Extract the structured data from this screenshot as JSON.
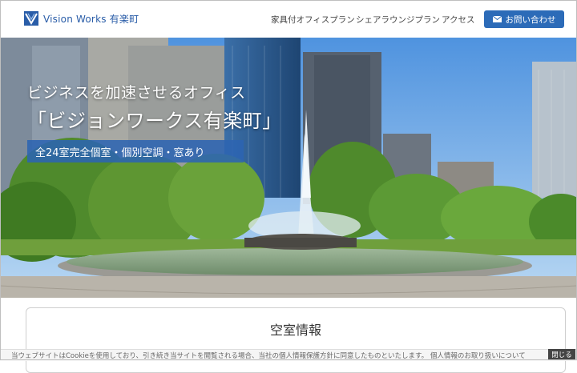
{
  "header": {
    "logo_text": "Vision Works 有楽町",
    "nav": [
      "家具付オフィスプラン",
      "シェアラウンジプラン",
      "アクセス"
    ],
    "contact_button": "お問い合わせ"
  },
  "hero": {
    "tagline": "ビジネスを加速させるオフィス",
    "name": "「ビジョンワークス有楽町」",
    "badge": "全24室完全個室・個別空調・窓あり"
  },
  "vacancy": {
    "title": "空室情報"
  },
  "cookie": {
    "text": "当ウェブサイトはCookieを使用しており、引き続き当サイトを閲覧される場合、当社の個人情報保護方針に同意したものといたします。 個人情報のお取り扱いについて",
    "close": "閉じる"
  },
  "colors": {
    "brand": "#2c6bb8",
    "sky": "#5d9fe2"
  }
}
